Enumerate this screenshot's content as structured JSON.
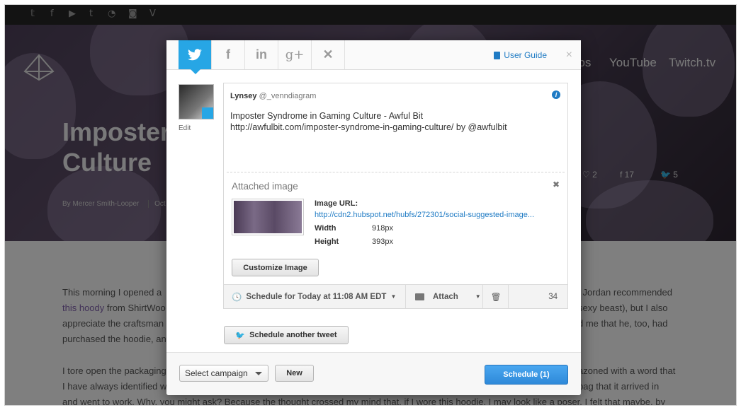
{
  "page": {
    "social_icons": [
      "twitter-icon",
      "facebook-icon",
      "youtube-icon",
      "tumblr-icon",
      "rss-icon",
      "instagram-icon",
      "vine-icon"
    ],
    "social_glyphs": [
      "𝕥",
      "f",
      "▶",
      "t",
      "◔",
      "◙",
      "V"
    ],
    "nav": [
      "eos",
      "YouTube",
      "Twitch.tv"
    ],
    "hero_title_line1": "Imposter",
    "hero_title_line2": "Culture",
    "byline": "By Mercer Smith-Looper",
    "byline_date": "Oct",
    "like_count": "2",
    "fb_count": "17",
    "tw_count": "5",
    "article": {
      "line1_left": "This morning I opened a",
      "line1_right": "l Jordan recommended",
      "line2_link": "this hoody",
      "line2_mid": " from ShirtWoo",
      "line2_right": "sexy beast), but I also",
      "line3_left": "appreciate the craftsman",
      "line3_right": "d me that he, too, had",
      "line4_left": "purchased the hoodie, an",
      "line5_left": "I tore open the packaging",
      "line5_right": "azoned with a word that",
      "line6_left": "I have always identified w",
      "line6_right": "bag that it arrived in",
      "line7": "and went to work. Why, you might ask? Because the thought crossed my mind that, if I wore this hoodie, I may look like a poser. I felt that maybe, by"
    }
  },
  "modal": {
    "tabs": [
      {
        "name": "twitter",
        "glyph": "🐦",
        "active": true
      },
      {
        "name": "facebook",
        "glyph": "f",
        "active": false
      },
      {
        "name": "linkedin",
        "glyph": "in",
        "active": false
      },
      {
        "name": "google-plus",
        "glyph": "g+",
        "active": false
      },
      {
        "name": "xing",
        "glyph": "✕",
        "active": false
      }
    ],
    "user_guide": "User Guide",
    "close": "×",
    "edit": "Edit",
    "author_name": "Lynsey",
    "author_handle": "@_venndiagram",
    "tweet_text_line1": "Imposter Syndrome in Gaming Culture - Awful Bit",
    "tweet_text_line2": "http://awfulbit.com/imposter-syndrome-in-gaming-culture/ by @awfulbit",
    "attached_image_title": "Attached image",
    "image_url_label": "Image URL:",
    "image_url": "http://cdn2.hubspot.net/hubfs/272301/social-suggested-image...",
    "width_label": "Width",
    "width_value": "918px",
    "height_label": "Height",
    "height_value": "393px",
    "customize_image": "Customize Image",
    "schedule_label": "Schedule for Today at 11:08 AM EDT",
    "attach_label": "Attach",
    "char_count": "34",
    "schedule_another": "Schedule another tweet",
    "select_campaign": "Select campaign",
    "new_button": "New",
    "schedule_button": "Schedule (1)",
    "accent_color": "#27a6e5"
  }
}
